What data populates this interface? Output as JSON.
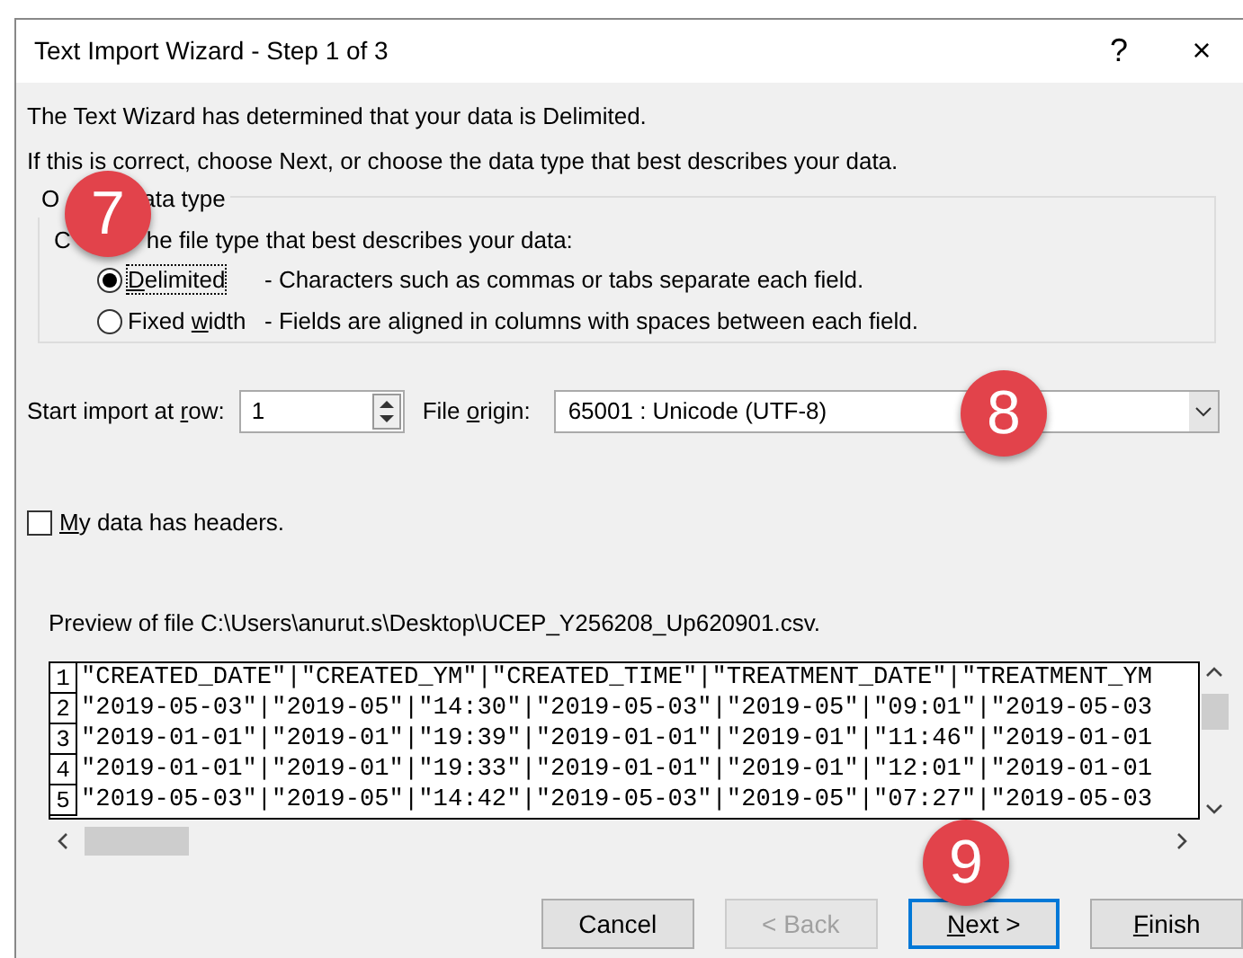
{
  "window": {
    "title": "Text Import Wizard - Step 1 of 3",
    "help": "?",
    "close": "×"
  },
  "intro": [
    "The Text Wizard has determined that your data is Delimited.",
    "If this is correct, choose Next, or choose the data type that best describes your data."
  ],
  "group": {
    "label_parts": [
      "O",
      "ata type"
    ],
    "prompt_parts": [
      "C",
      "he file type that best describes your data:"
    ],
    "options": [
      {
        "label": {
          "key": "D",
          "after": "elimited"
        },
        "description": "- Characters such as commas or tabs separate each field.",
        "selected": true,
        "focused": true
      },
      {
        "label": {
          "before": "Fixed ",
          "key": "w",
          "after": "idth"
        },
        "description": "- Fields are aligned in columns with spaces between each field.",
        "selected": false,
        "focused": false
      }
    ]
  },
  "start_row": {
    "label": {
      "before": "Start import at ",
      "key": "r",
      "after": "ow:"
    },
    "value": "1"
  },
  "file_origin": {
    "label": {
      "before": "File ",
      "key": "o",
      "after": "rigin:"
    },
    "value": "65001 : Unicode (UTF-8)"
  },
  "headers": {
    "label": {
      "key": "M",
      "after": "y data has headers."
    },
    "checked": false
  },
  "preview": {
    "title": "Preview of file C:\\Users\\anurut.s\\Desktop\\UCEP_Y256208_Up620901.csv.",
    "rows": [
      {
        "number": "1",
        "text": "\"CREATED_DATE\"|\"CREATED_YM\"|\"CREATED_TIME\"|\"TREATMENT_DATE\"|\"TREATMENT_YM"
      },
      {
        "number": "2",
        "text": "\"2019-05-03\"|\"2019-05\"|\"14:30\"|\"2019-05-03\"|\"2019-05\"|\"09:01\"|\"2019-05-03"
      },
      {
        "number": "3",
        "text": "\"2019-01-01\"|\"2019-01\"|\"19:39\"|\"2019-01-01\"|\"2019-01\"|\"11:46\"|\"2019-01-01"
      },
      {
        "number": "4",
        "text": "\"2019-01-01\"|\"2019-01\"|\"19:33\"|\"2019-01-01\"|\"2019-01\"|\"12:01\"|\"2019-01-01"
      },
      {
        "number": "5",
        "text": "\"2019-05-03\"|\"2019-05\"|\"14:42\"|\"2019-05-03\"|\"2019-05\"|\"07:27\"|\"2019-05-03"
      }
    ]
  },
  "buttons": [
    {
      "label": {
        "after": "Cancel"
      },
      "disabled": false,
      "default": false
    },
    {
      "label": {
        "after": "< Back"
      },
      "disabled": true,
      "default": false
    },
    {
      "label": {
        "key": "N",
        "after": "ext >"
      },
      "disabled": false,
      "default": true
    },
    {
      "label": {
        "key": "F",
        "after": "inish"
      },
      "disabled": false,
      "default": false
    }
  ],
  "step_markers": [
    {
      "label": "7"
    },
    {
      "label": "8"
    },
    {
      "label": "9"
    }
  ]
}
